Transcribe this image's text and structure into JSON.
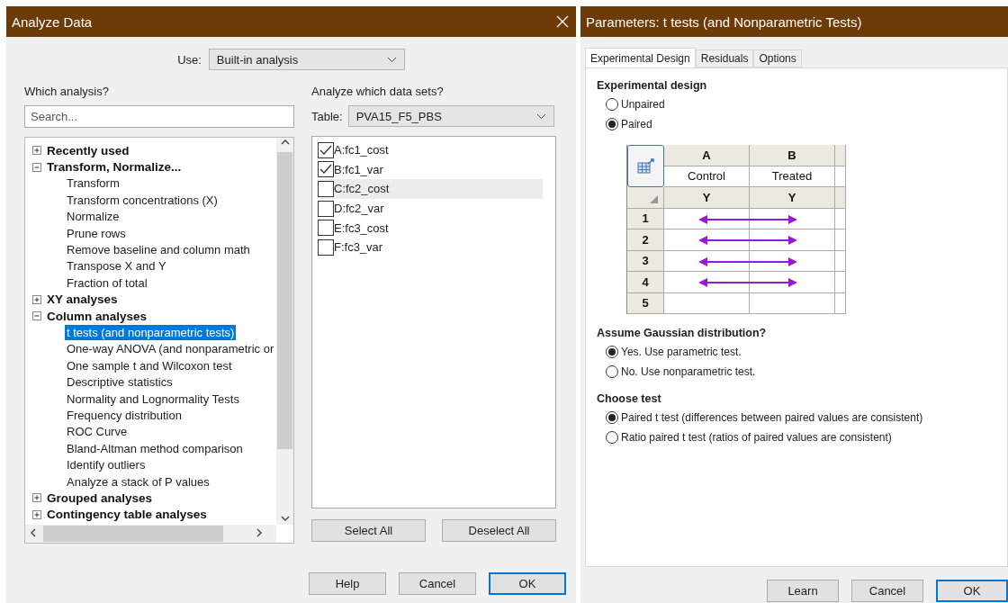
{
  "analyze_dialog": {
    "title": "Analyze Data",
    "use": {
      "label": "Use:",
      "value": "Built-in analysis"
    },
    "which_analysis": {
      "heading": "Which analysis?",
      "search": {
        "placeholder": "Search..."
      },
      "tree": [
        {
          "label": "Recently used",
          "expanded": false
        },
        {
          "label": "Transform, Normalize...",
          "expanded": true,
          "children": [
            {
              "label": "Transform",
              "selected": false
            },
            {
              "label": "Transform concentrations (X)",
              "selected": false
            },
            {
              "label": "Normalize",
              "selected": false
            },
            {
              "label": "Prune rows",
              "selected": false
            },
            {
              "label": "Remove baseline and column math",
              "selected": false
            },
            {
              "label": "Transpose X and Y",
              "selected": false
            },
            {
              "label": "Fraction of total",
              "selected": false
            }
          ]
        },
        {
          "label": "XY analyses",
          "expanded": false
        },
        {
          "label": "Column analyses",
          "expanded": true,
          "children": [
            {
              "label": "t tests (and nonparametric tests)",
              "selected": true
            },
            {
              "label": "One-way ANOVA (and nonparametric or",
              "selected": false
            },
            {
              "label": "One sample t and Wilcoxon test",
              "selected": false
            },
            {
              "label": "Descriptive statistics",
              "selected": false
            },
            {
              "label": "Normality and Lognormality Tests",
              "selected": false
            },
            {
              "label": "Frequency distribution",
              "selected": false
            },
            {
              "label": "ROC Curve",
              "selected": false
            },
            {
              "label": "Bland-Altman method comparison",
              "selected": false
            },
            {
              "label": "Identify outliers",
              "selected": false
            },
            {
              "label": "Analyze a stack of P values",
              "selected": false
            }
          ]
        },
        {
          "label": "Grouped analyses",
          "expanded": false
        },
        {
          "label": "Contingency table analyses",
          "expanded": false
        }
      ]
    },
    "data_sets": {
      "heading": "Analyze which data sets?",
      "table_label": "Table:",
      "table_value": "PVA15_F5_PBS",
      "items": [
        {
          "label": "A:fc1_cost",
          "checked": true,
          "hovered": false
        },
        {
          "label": "B:fc1_var",
          "checked": true,
          "hovered": false
        },
        {
          "label": "C:fc2_cost",
          "checked": false,
          "hovered": true
        },
        {
          "label": "D:fc2_var",
          "checked": false,
          "hovered": false
        },
        {
          "label": "E:fc3_cost",
          "checked": false,
          "hovered": false
        },
        {
          "label": "F:fc3_var",
          "checked": false,
          "hovered": false
        }
      ]
    },
    "select_buttons": [
      "Select All",
      "Deselect All"
    ],
    "buttons": [
      {
        "label": "Help",
        "default": false
      },
      {
        "label": "Cancel",
        "default": false
      },
      {
        "label": "OK",
        "default": true
      }
    ]
  },
  "parameters_dialog": {
    "title": "Parameters: t tests (and Nonparametric Tests)",
    "tabs": [
      {
        "label": "Experimental Design",
        "selected": true
      },
      {
        "label": "Residuals",
        "selected": false
      },
      {
        "label": "Options",
        "selected": false
      }
    ],
    "sections": [
      {
        "heading": "Experimental design",
        "options": [
          {
            "label": "Unpaired",
            "selected": false
          },
          {
            "label": "Paired",
            "selected": true
          }
        ],
        "table": {
          "columns": [
            {
              "letter": "A",
              "title": "Control",
              "type": "Y"
            },
            {
              "letter": "B",
              "title": "Treated",
              "type": "Y"
            }
          ],
          "rows": [
            {
              "number": "1",
              "paired": true
            },
            {
              "number": "2",
              "paired": true
            },
            {
              "number": "3",
              "paired": true
            },
            {
              "number": "4",
              "paired": true
            },
            {
              "number": "5",
              "paired": false
            }
          ]
        }
      },
      {
        "heading": "Assume Gaussian distribution?",
        "options": [
          {
            "label": "Yes. Use parametric test.",
            "selected": true
          },
          {
            "label": "No. Use nonparametric test.",
            "selected": false
          }
        ]
      },
      {
        "heading": "Choose test",
        "options": [
          {
            "label": "Paired t test (differences between paired values are consistent)",
            "selected": true
          },
          {
            "label": "Ratio paired t test (ratios of paired values are consistent)",
            "selected": false
          }
        ]
      }
    ],
    "buttons": [
      {
        "label": "Learn",
        "default": false
      },
      {
        "label": "Cancel",
        "default": false
      },
      {
        "label": "OK",
        "default": true
      }
    ]
  }
}
